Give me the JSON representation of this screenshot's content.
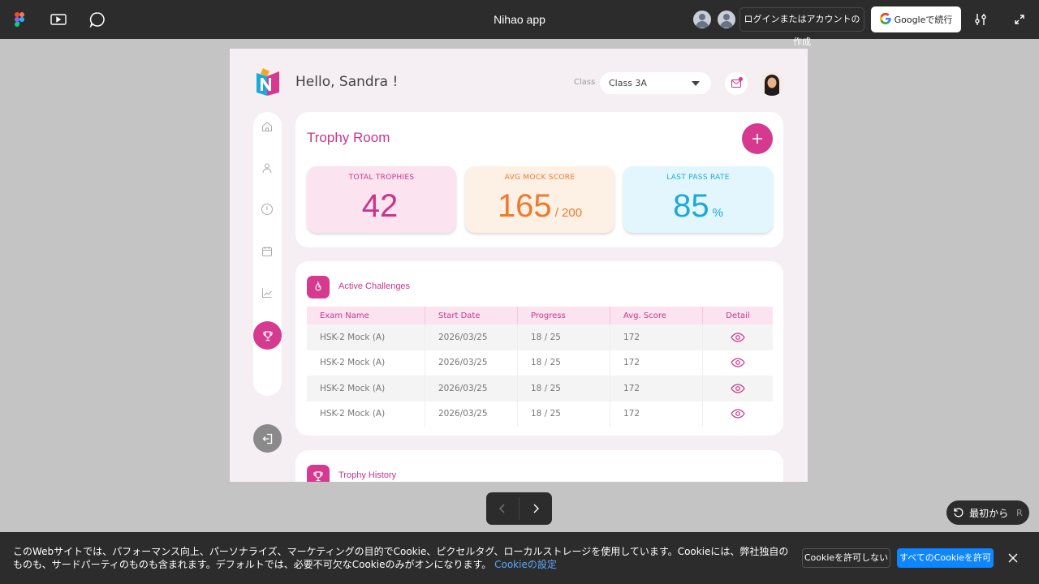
{
  "figma": {
    "title": "Nihao app",
    "login_label": "ログインまたはアカウントの作成",
    "google_label": "Googleで続行",
    "restart_label": "最初から",
    "restart_key": "R"
  },
  "app": {
    "greeting": "Hello, Sandra !",
    "class_label": "Class",
    "class_value": "Class 3A",
    "trophy_room": {
      "title": "Trophy Room",
      "stats": [
        {
          "label": "TOTAL TROPHIES",
          "value": "42",
          "unit": "",
          "color": "#c8368a",
          "bg": "#fbe3ef"
        },
        {
          "label": "AVG MOCK SCORE",
          "value": "165",
          "unit": "/ 200",
          "color": "#ef7a2c",
          "bg": "#fdf0e4"
        },
        {
          "label": "LAST PASS RATE",
          "value": "85",
          "unit": "%",
          "color": "#1aa9d8",
          "bg": "#e3f6fd"
        }
      ]
    },
    "challenges": {
      "title": "Active Challenges",
      "headers": [
        "Exam Name",
        "Start Date",
        "Progress",
        "Avg. Score",
        "Detail"
      ],
      "rows": [
        [
          "HSK-2 Mock (A)",
          "2026/03/25",
          "18 / 25",
          "172"
        ],
        [
          "HSK-2 Mock (A)",
          "2026/03/25",
          "18 / 25",
          "172"
        ],
        [
          "HSK-2 Mock (A)",
          "2026/03/25",
          "18 / 25",
          "172"
        ],
        [
          "HSK-2 Mock (A)",
          "2026/03/25",
          "18 / 25",
          "172"
        ]
      ]
    },
    "history": {
      "title": "Trophy History"
    }
  },
  "cookie": {
    "text": "このWebサイトでは、パフォーマンス向上、パーソナライズ、マーケティングの目的でCookie、ピクセルタグ、ローカルストレージを使用しています。Cookieには、弊社独自のものも、サードパーティのものも含まれます。デフォルトでは、必要不可欠なCookieのみがオンになります。",
    "link": "Cookieの設定",
    "deny_label": "Cookieを許可しない",
    "allow_label": "すべてのCookieを許可"
  },
  "icons": {
    "figma": "figma-logo-icon",
    "present": "present-icon",
    "comment": "comment-icon",
    "settings": "sliders-icon",
    "expand": "expand-icon",
    "home": "home-icon",
    "user": "user-icon",
    "alert": "alert-icon",
    "calendar": "calendar-icon",
    "chart": "chart-icon",
    "trophy": "trophy-icon",
    "logout": "logout-icon",
    "mail": "mail-icon",
    "eye": "eye-icon",
    "flame": "flame-icon"
  }
}
